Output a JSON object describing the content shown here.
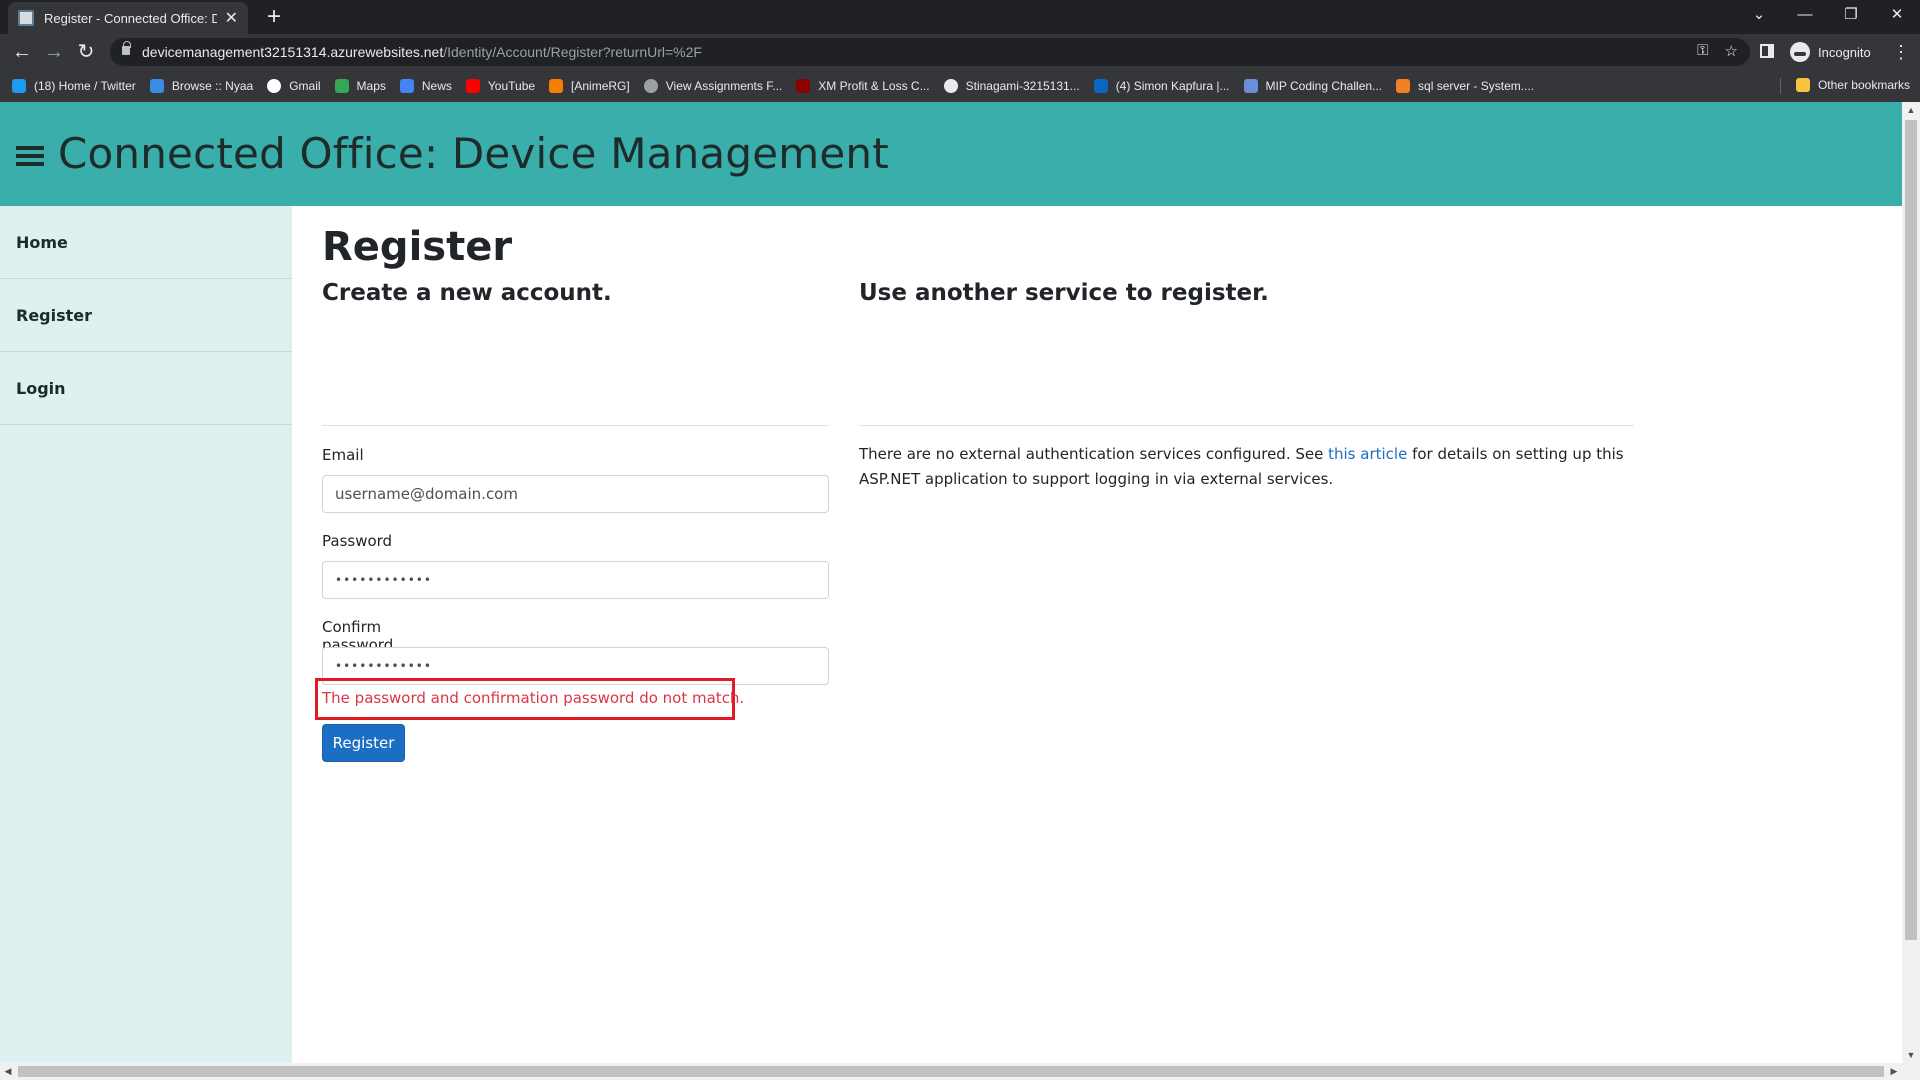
{
  "browser": {
    "tab_title": "Register - Connected Office: Dev",
    "new_tab": "+",
    "close_tab": "✕",
    "url_host": "devicemanagement32151314.azurewebsites.net",
    "url_path": "/Identity/Account/Register?returnUrl=%2F",
    "incognito_label": "Incognito",
    "bookmarks": [
      {
        "label": "(18) Home / Twitter",
        "icon": "twitter-icon",
        "color": "#1d9bf0"
      },
      {
        "label": "Browse :: Nyaa",
        "icon": "nyaa-icon",
        "color": "#3c8be3"
      },
      {
        "label": "Gmail",
        "icon": "google-icon",
        "color": "#ffffff"
      },
      {
        "label": "Maps",
        "icon": "maps-icon",
        "color": "#34a853"
      },
      {
        "label": "News",
        "icon": "news-icon",
        "color": "#4285f4"
      },
      {
        "label": "YouTube",
        "icon": "youtube-icon",
        "color": "#ff0000"
      },
      {
        "label": "[AnimeRG]",
        "icon": "blogger-icon",
        "color": "#f57d00"
      },
      {
        "label": "View Assignments F...",
        "icon": "globe-icon",
        "color": "#9aa0a6"
      },
      {
        "label": "XM Profit & Loss C...",
        "icon": "xm-icon",
        "color": "#8b0000"
      },
      {
        "label": "Stinagami-3215131...",
        "icon": "github-icon",
        "color": "#e8eaed"
      },
      {
        "label": "(4) Simon Kapfura |...",
        "icon": "linkedin-icon",
        "color": "#0a66c2"
      },
      {
        "label": "MIP Coding Challen...",
        "icon": "mip-icon",
        "color": "#6a8ed8"
      },
      {
        "label": "sql server - System....",
        "icon": "stackoverflow-icon",
        "color": "#f48024"
      }
    ],
    "other_bookmarks": "Other bookmarks"
  },
  "app": {
    "title": "Connected Office: Device Management",
    "nav": [
      "Home",
      "Register",
      "Login"
    ]
  },
  "page": {
    "heading": "Register",
    "form_heading": "Create a new account.",
    "email_label": "Email",
    "email_placeholder": "username@domain.com",
    "password_label": "Password",
    "password_value": "••••••••••••",
    "confirm_label": "Confirm password",
    "confirm_value": "••••••••••••",
    "error_message": "The password and confirmation password do not match.",
    "register_button": "Register",
    "external_heading": "Use another service to register.",
    "external_text_before": "There are no external authentication services configured. See ",
    "external_link": "this article",
    "external_text_after": " for details on setting up this ASP.NET application to support logging in via external services."
  },
  "colors": {
    "header": "#3aaeaa",
    "sidebar": "#dcf1f0",
    "primary_button": "#1b6ec2",
    "error": "#dc3545",
    "highlight_box": "#e01b24"
  }
}
